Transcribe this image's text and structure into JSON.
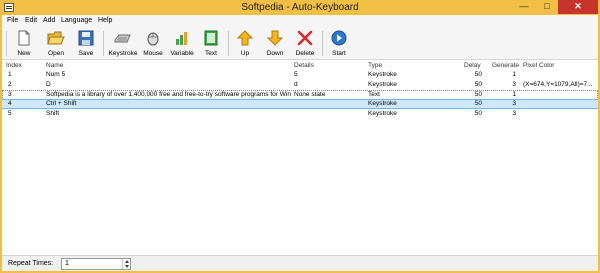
{
  "window": {
    "title": "Softpedia - Auto-Keyboard",
    "minimize_symbol": "—",
    "maximize_symbol": "□",
    "close_symbol": "✕"
  },
  "menu": [
    "File",
    "Edit",
    "Add",
    "Language",
    "Help"
  ],
  "toolbar": {
    "new": "New",
    "open": "Open",
    "save": "Save",
    "keystroke": "Keystroke",
    "mouse": "Mouse",
    "variable": "Variable",
    "text": "Text",
    "up": "Up",
    "down": "Down",
    "delete": "Delete",
    "start": "Start"
  },
  "table": {
    "headers": [
      "Index",
      "Name",
      "Details",
      "Type",
      "Delay",
      "Generate",
      "Pixel Color"
    ],
    "rows": [
      [
        "1",
        "Num 5",
        "5",
        "Keystroke",
        "50",
        "1",
        ""
      ],
      [
        "2",
        "D",
        "d",
        "Keystroke",
        "50",
        "3",
        "(X=674,Y=1079,All)=7..."
      ],
      [
        "3",
        "Softpedia is a library of over 1,400,000 free and free-to-try software programs for Wind...",
        "None state",
        "Text",
        "50",
        "1",
        ""
      ],
      [
        "4",
        "Ctrl + Shift",
        "",
        "Keystroke",
        "50",
        "3",
        ""
      ],
      [
        "5",
        "Shift",
        "",
        "Keystroke",
        "50",
        "3",
        ""
      ]
    ]
  },
  "status": {
    "repeat_label": "Repeat Times:",
    "repeat_value": "1"
  },
  "colors": {
    "frame": "#f0bf43",
    "selection": "#cde8fb",
    "close_button": "#c7342c"
  }
}
